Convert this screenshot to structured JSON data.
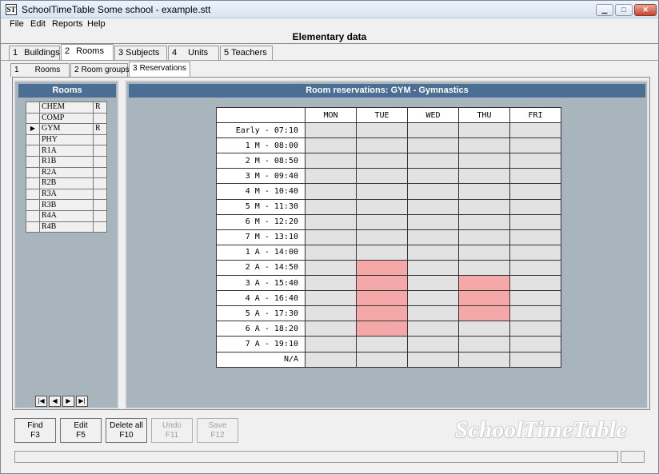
{
  "window": {
    "title": "SchoolTimeTable Some school - example.stt",
    "icon": "ST"
  },
  "menu": [
    "File",
    "Edit",
    "Reports",
    "Help"
  ],
  "section_title": "Elementary data",
  "tabs": [
    {
      "num": "1",
      "label": "Buildings"
    },
    {
      "num": "2",
      "label": "Rooms"
    },
    {
      "num": "3",
      "label": "Subjects"
    },
    {
      "num": "4",
      "label": "Units"
    },
    {
      "num": "5",
      "label": "Teachers"
    }
  ],
  "subtabs": [
    {
      "num": "1",
      "label": "Rooms"
    },
    {
      "num": "2",
      "label": "Room groups"
    },
    {
      "num": "3",
      "label": "Reservations"
    }
  ],
  "rooms_panel": {
    "header": "Rooms",
    "rows": [
      {
        "name": "CHEM",
        "flag": "R",
        "current": false
      },
      {
        "name": "COMP",
        "flag": "",
        "current": false
      },
      {
        "name": "GYM",
        "flag": "R",
        "current": true
      },
      {
        "name": "PHY",
        "flag": "",
        "current": false
      },
      {
        "name": "R1A",
        "flag": "",
        "current": false
      },
      {
        "name": "R1B",
        "flag": "",
        "current": false
      },
      {
        "name": "R2A",
        "flag": "",
        "current": false
      },
      {
        "name": "R2B",
        "flag": "",
        "current": false
      },
      {
        "name": "R3A",
        "flag": "",
        "current": false
      },
      {
        "name": "R3B",
        "flag": "",
        "current": false
      },
      {
        "name": "R4A",
        "flag": "",
        "current": false
      },
      {
        "name": "R4B",
        "flag": "",
        "current": false
      }
    ],
    "current_marker": "▶",
    "nav": [
      "|◀",
      "◀",
      "▶",
      "▶|"
    ]
  },
  "reservations": {
    "header": "Room reservations:  GYM - Gymnastics",
    "days": [
      "MON",
      "TUE",
      "WED",
      "THU",
      "FRI"
    ],
    "periods": [
      "Early - 07:10",
      "1 M - 08:00",
      "2 M - 08:50",
      "3 M - 09:40",
      "4 M - 10:40",
      "5 M - 11:30",
      "6 M - 12:20",
      "7 M - 13:10",
      "1 A - 14:00",
      "2 A - 14:50",
      "3 A - 15:40",
      "4 A - 16:40",
      "5 A - 17:30",
      "6 A - 18:20",
      "7 A - 19:10",
      "N/A"
    ],
    "reserved": [
      [
        0,
        0,
        0,
        0,
        0
      ],
      [
        0,
        0,
        0,
        0,
        0
      ],
      [
        0,
        0,
        0,
        0,
        0
      ],
      [
        0,
        0,
        0,
        0,
        0
      ],
      [
        0,
        0,
        0,
        0,
        0
      ],
      [
        0,
        0,
        0,
        0,
        0
      ],
      [
        0,
        0,
        0,
        0,
        0
      ],
      [
        0,
        0,
        0,
        0,
        0
      ],
      [
        0,
        0,
        0,
        0,
        0
      ],
      [
        0,
        1,
        0,
        0,
        0
      ],
      [
        0,
        1,
        0,
        1,
        0
      ],
      [
        0,
        1,
        0,
        1,
        0
      ],
      [
        0,
        1,
        0,
        1,
        0
      ],
      [
        0,
        1,
        0,
        0,
        0
      ],
      [
        0,
        0,
        0,
        0,
        0
      ],
      [
        0,
        0,
        0,
        0,
        0
      ]
    ],
    "reserved_color": "#f4a8a8",
    "free_color": "#e2e2e2"
  },
  "buttons": [
    {
      "label": "Find",
      "key": "F3",
      "enabled": true
    },
    {
      "label": "Edit",
      "key": "F5",
      "enabled": true
    },
    {
      "label": "Delete all",
      "key": "F10",
      "enabled": true
    },
    {
      "label": "Undo",
      "key": "F11",
      "enabled": false
    },
    {
      "label": "Save",
      "key": "F12",
      "enabled": false
    }
  ],
  "brand": "SchoolTimeTable",
  "colors": {
    "panel_header": "#4a6e94",
    "panel_bg": "#a9b5bd"
  }
}
